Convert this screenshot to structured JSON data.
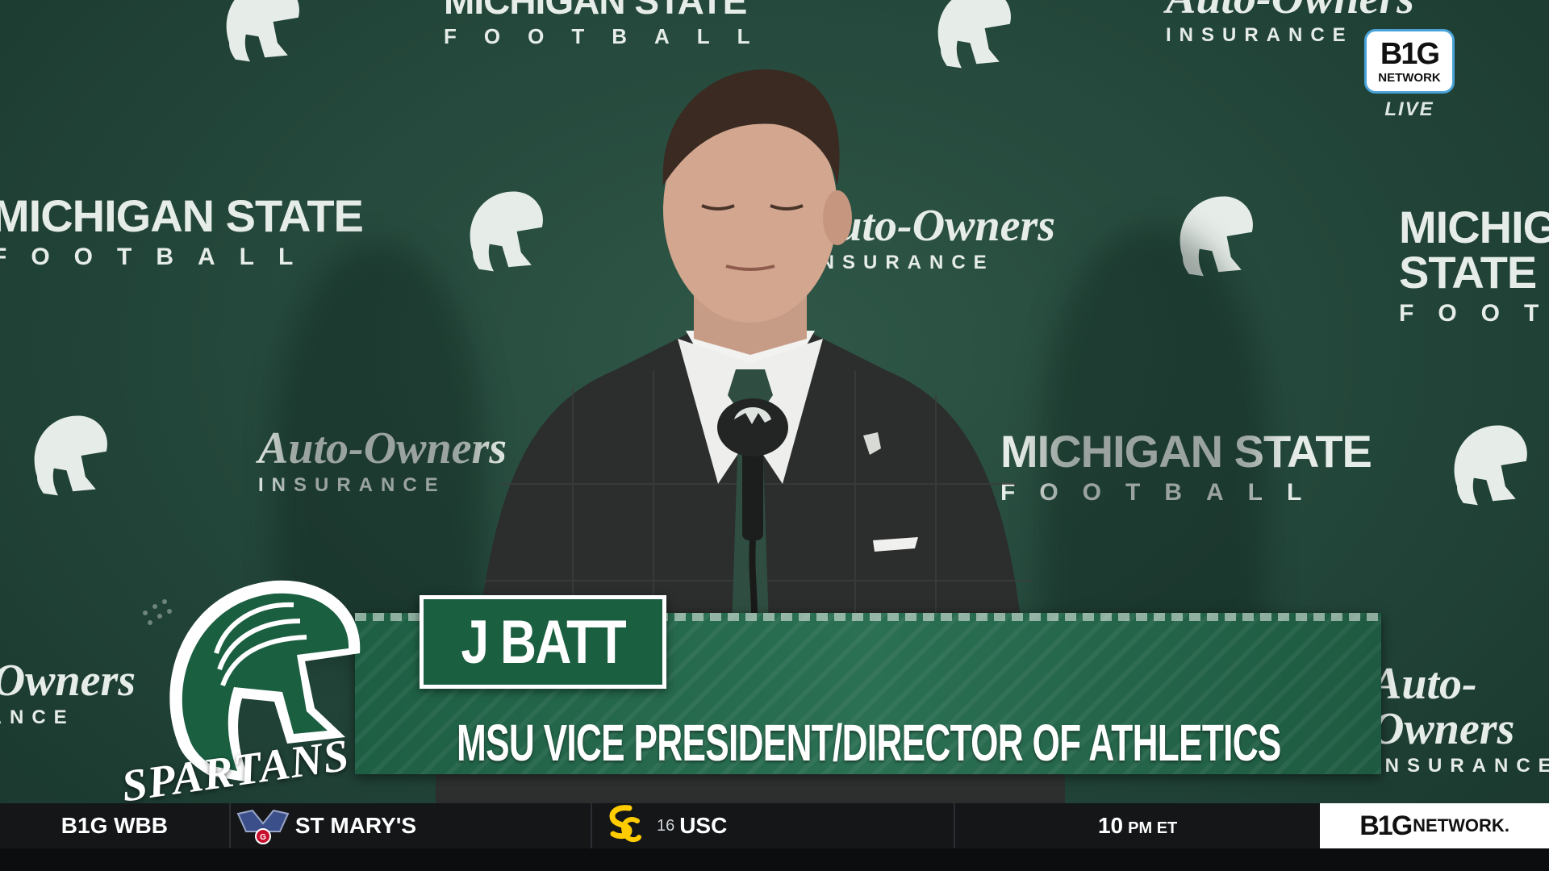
{
  "backdrop": {
    "msu_line1": "MICHIGAN STATE",
    "msu_line2": "FOOTBALL",
    "sponsor_line1": "Auto-Owners",
    "sponsor_line2": "INSURANCE"
  },
  "network_bug": {
    "logo": "B1G",
    "network": "NETWORK",
    "status": "LIVE"
  },
  "lower_third": {
    "name": "J BATT",
    "title": "MSU VICE PRESIDENT/DIRECTOR OF ATHLETICS",
    "emblem_text": "SPARTANS"
  },
  "ticker": {
    "league": "B1G WBB",
    "team1": {
      "name": "ST MARY'S",
      "logo_icon": "saint-marys-logo"
    },
    "team2": {
      "rank": "16",
      "name": "USC",
      "logo_icon": "usc-sc-logo"
    },
    "time": "10",
    "time_suffix": "PM ET",
    "brand_logo": "B1G",
    "brand_text": "NETWORK."
  },
  "colors": {
    "msu_green": "#1b5f41",
    "backdrop_green": "#23463a",
    "ticker_bg": "#141618",
    "usc_gold": "#ffcc00"
  }
}
